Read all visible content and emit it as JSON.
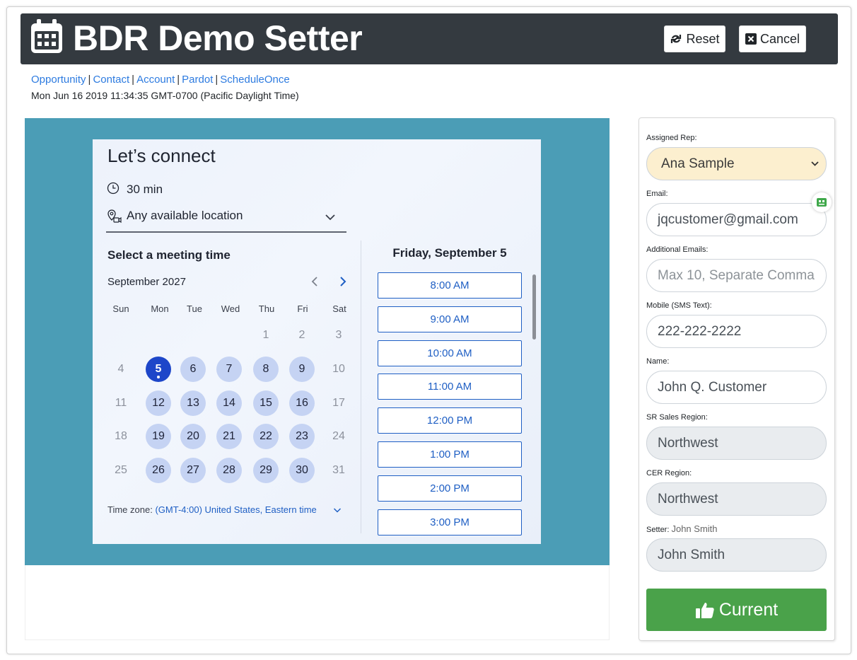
{
  "header": {
    "title": "BDR Demo Setter",
    "reset_label": "Reset",
    "cancel_label": "Cancel"
  },
  "links": [
    "Opportunity",
    "Contact",
    "Account",
    "Pardot",
    "ScheduleOnce"
  ],
  "datetime": "Mon Jun 16 2019 11:34:35 GMT-0700 (Pacific Daylight Time)",
  "scheduler": {
    "heading": "Let’s connect",
    "duration": "30 min",
    "location": "Any available location",
    "select_title": "Select a meeting time",
    "month": "September 2027",
    "weekdays": [
      "Sun",
      "Mon",
      "Tue",
      "Wed",
      "Thu",
      "Fri",
      "Sat"
    ],
    "weeks": [
      [
        "",
        "",
        "",
        "",
        "1",
        "2",
        "3"
      ],
      [
        "4",
        "5",
        "6",
        "7",
        "8",
        "9",
        "10"
      ],
      [
        "11",
        "12",
        "13",
        "14",
        "15",
        "16",
        "17"
      ],
      [
        "18",
        "19",
        "20",
        "21",
        "22",
        "23",
        "24"
      ],
      [
        "25",
        "26",
        "27",
        "28",
        "29",
        "30",
        "31"
      ]
    ],
    "selected_day": "5",
    "available_days": [
      "5",
      "6",
      "7",
      "8",
      "9",
      "12",
      "13",
      "14",
      "15",
      "16",
      "19",
      "20",
      "21",
      "22",
      "23",
      "26",
      "27",
      "28",
      "29",
      "30"
    ],
    "timezone_label": "Time zone:",
    "timezone_value": "(GMT-4:00) United States, Eastern time",
    "slot_date": "Friday, September 5",
    "slots": [
      "8:00 AM",
      "9:00 AM",
      "10:00 AM",
      "11:00 AM",
      "12:00 PM",
      "1:00 PM",
      "2:00 PM",
      "3:00 PM"
    ]
  },
  "panel": {
    "assigned_rep_label": "Assigned Rep:",
    "assigned_rep_value": "Ana Sample",
    "email_label": "Email:",
    "email_value": "jqcustomer@gmail.com",
    "additional_emails_label": "Additional Emails:",
    "additional_emails_placeholder": "Max 10, Separate  Comma",
    "mobile_label": "Mobile (SMS Text):",
    "mobile_value": "222-222-2222",
    "name_label": "Name:",
    "name_value": "John Q. Customer",
    "sr_region_label": "SR Sales Region:",
    "sr_region_value": "Northwest",
    "cer_region_label": "CER Region:",
    "cer_region_value": "Northwest",
    "setter_label": "Setter:",
    "setter_label_value": "John Smith",
    "setter_value": "John Smith",
    "current_label": "Current"
  },
  "colors": {
    "header_bg": "#343a40",
    "embed_bg": "#4b9db6",
    "selected_day": "#1d46c9",
    "available_day": "#c5d3f3",
    "slot_blue": "#1f5fc4",
    "current_green": "#4aa24a",
    "rep_select_bg": "#fcefcf"
  }
}
